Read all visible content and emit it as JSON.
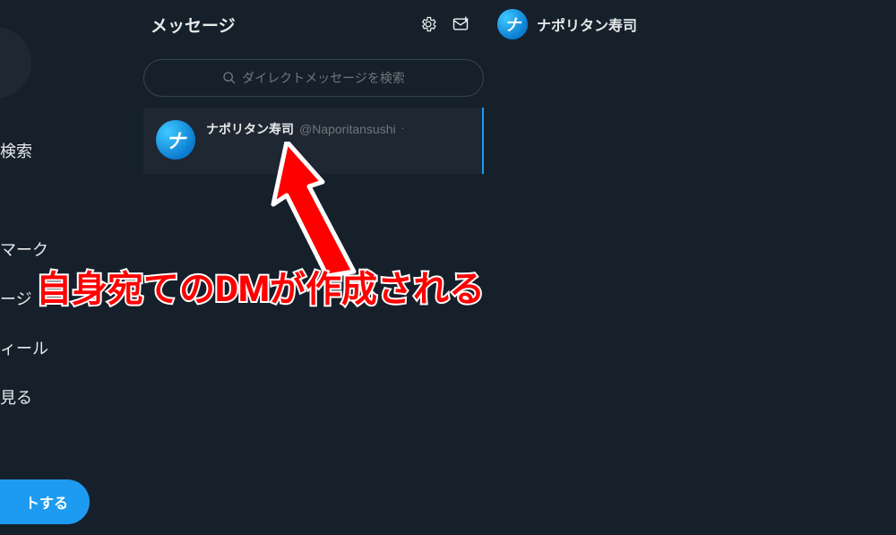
{
  "sidebar": {
    "items": [
      {
        "label": "検索"
      },
      {
        "label": "マーク"
      },
      {
        "label": "ージ"
      },
      {
        "label": "ィール"
      },
      {
        "label": "見る"
      }
    ],
    "tweet_label": "トする"
  },
  "messages": {
    "title": "メッセージ",
    "search_placeholder": "ダイレクトメッセージを検索",
    "conversations": [
      {
        "name": "ナポリタン寿司",
        "handle": "@Naporitansushi"
      }
    ]
  },
  "right_pane": {
    "name": "ナポリタン寿司"
  },
  "annotation": {
    "text": "自身宛てのDMが作成される"
  }
}
